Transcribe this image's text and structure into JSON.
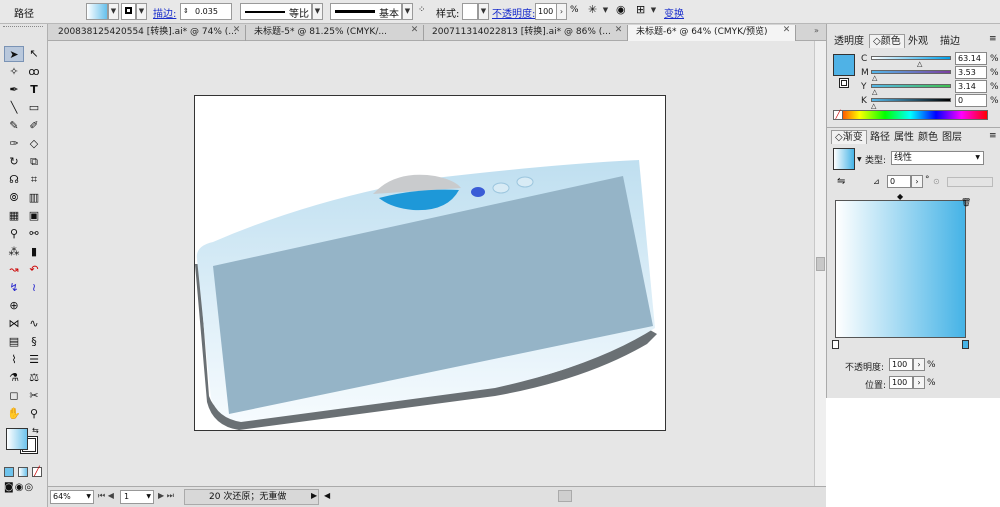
{
  "control_bar": {
    "object_type": "路径",
    "stroke_link": "描边:",
    "stroke_width": "0.035",
    "profile_label": "等比",
    "brush_label": "基本",
    "style_label": "样式:",
    "opacity_link": "不透明度:",
    "opacity_value": "100",
    "opacity_unit": "%",
    "transform_link": "变换"
  },
  "doc_tabs": [
    {
      "label": "200838125420554 [转换].ai* @ 74% (...",
      "active": false
    },
    {
      "label": "未标题-5* @ 81.25% (CMYK/...",
      "active": false
    },
    {
      "label": "200711314022813 [转换].ai* @ 86% (...",
      "active": false
    },
    {
      "label": "未标题-6* @ 64% (CMYK/预览)",
      "active": true
    }
  ],
  "status_bar": {
    "zoom": "64%",
    "artboard": "1",
    "history": "20 次还原；无重做"
  },
  "color_panel": {
    "tabs": [
      "透明度",
      "颜色",
      "外观",
      "描边"
    ],
    "active_tab": "颜色",
    "fill_color": "#4fb2e6",
    "channels": [
      {
        "label": "C",
        "value": "63.14",
        "fraction": 0.6314,
        "gradient": [
          "#ffffff",
          "#00a0e9"
        ]
      },
      {
        "label": "M",
        "value": "3.53",
        "fraction": 0.0353,
        "gradient": [
          "#55b8ea",
          "#7a3ea0"
        ]
      },
      {
        "label": "Y",
        "value": "3.14",
        "fraction": 0.0314,
        "gradient": [
          "#55b8ea",
          "#3fbf50"
        ]
      },
      {
        "label": "K",
        "value": "0",
        "fraction": 0.0,
        "gradient": [
          "#55b8ea",
          "#000000"
        ]
      }
    ]
  },
  "gradient_panel": {
    "tabs": [
      "渐变",
      "路径",
      "属性",
      "颜色",
      "图层"
    ],
    "active_tab": "渐变",
    "type_label": "类型:",
    "type_value": "线性",
    "angle_value": "0",
    "degree": "°",
    "start_color": "#ffffff",
    "end_color": "#45b3e6",
    "opacity_label": "不透明度:",
    "opacity_value": "100",
    "location_label": "位置:",
    "location_value": "100",
    "unit": "%"
  },
  "artwork": {
    "frame_color": "#c5e2f0",
    "screen_color": "#95b4c7",
    "shadow_color": "#6a7074",
    "accent_color": "#1e98d8"
  }
}
